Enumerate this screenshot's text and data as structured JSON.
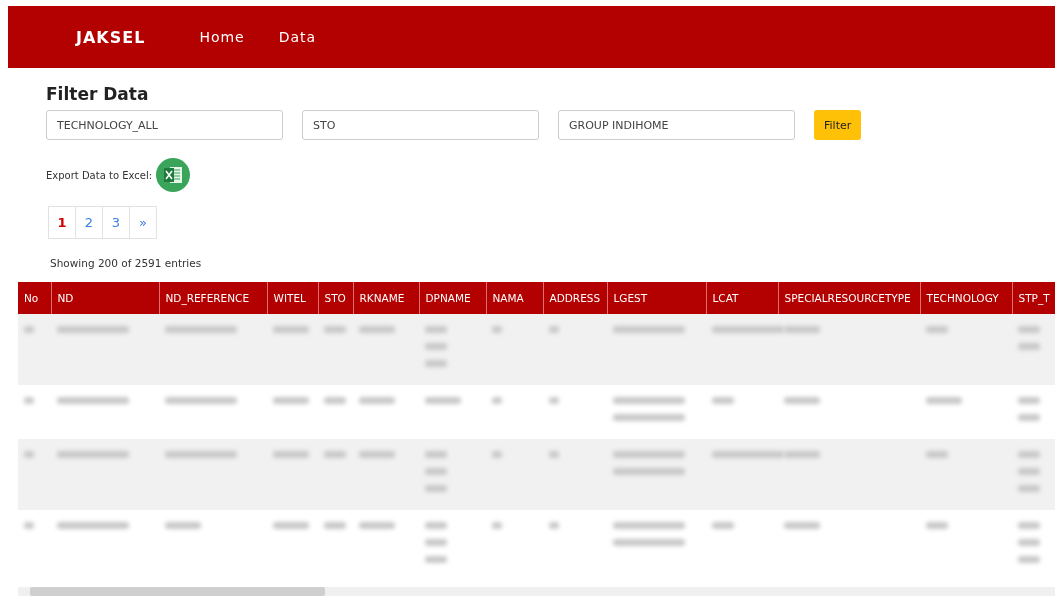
{
  "navbar": {
    "brand": "JAKSEL",
    "links": [
      {
        "label": "Home",
        "selected": false
      },
      {
        "label": "Data",
        "selected": false
      }
    ]
  },
  "filter": {
    "title": "Filter Data",
    "fields": [
      {
        "value": "TECHNOLOGY_ALL"
      },
      {
        "value": "STO"
      },
      {
        "value": "GROUP INDIHOME"
      }
    ],
    "button": "Filter"
  },
  "export": {
    "label": "Export Data to Excel:"
  },
  "pagination": {
    "pages": [
      {
        "label": "1",
        "selected": true
      },
      {
        "label": "2",
        "selected": false
      },
      {
        "label": "3",
        "selected": false
      },
      {
        "label": "»",
        "selected": false
      }
    ]
  },
  "summary": "Showing 200 of 2591 entries",
  "table": {
    "columns": [
      "No",
      "ND",
      "ND_REFERENCE",
      "WITEL",
      "STO",
      "RKNAME",
      "DPNAME",
      "NAMA",
      "ADDRESS",
      "LGEST",
      "LCAT",
      "SPECIALRESOURCETYPE",
      "TECHNOLOGY",
      "STP_T"
    ],
    "rows": [
      {
        "cells": [
          [
            {
              "kind": "tiny"
            }
          ],
          [
            {
              "kind": "long"
            }
          ],
          [
            {
              "kind": "long"
            }
          ],
          [
            {
              "kind": "medium"
            }
          ],
          [
            {
              "kind": "short"
            }
          ],
          [
            {
              "kind": "medium"
            }
          ],
          [
            {
              "kind": "short"
            },
            {
              "kind": "short"
            },
            {
              "kind": "short"
            }
          ],
          [
            {
              "kind": "tiny"
            }
          ],
          [
            {
              "kind": "tiny"
            }
          ],
          [
            {
              "kind": "long"
            }
          ],
          [
            {
              "kind": "long"
            }
          ],
          [
            {
              "kind": "medium"
            }
          ],
          [
            {
              "kind": "short"
            }
          ],
          [
            {
              "kind": "short"
            },
            {
              "kind": "short"
            }
          ]
        ]
      },
      {
        "cells": [
          [
            {
              "kind": "tiny"
            }
          ],
          [
            {
              "kind": "long"
            }
          ],
          [
            {
              "kind": "long"
            }
          ],
          [
            {
              "kind": "medium"
            }
          ],
          [
            {
              "kind": "short"
            }
          ],
          [
            {
              "kind": "medium"
            }
          ],
          [
            {
              "kind": "medium"
            }
          ],
          [
            {
              "kind": "tiny"
            }
          ],
          [
            {
              "kind": "tiny"
            }
          ],
          [
            {
              "kind": "long"
            },
            {
              "kind": "long"
            }
          ],
          [
            {
              "kind": "short"
            }
          ],
          [
            {
              "kind": "medium"
            }
          ],
          [
            {
              "kind": "medium"
            }
          ],
          [
            {
              "kind": "short"
            },
            {
              "kind": "short"
            }
          ]
        ]
      },
      {
        "cells": [
          [
            {
              "kind": "tiny"
            }
          ],
          [
            {
              "kind": "long"
            }
          ],
          [
            {
              "kind": "long"
            }
          ],
          [
            {
              "kind": "medium"
            }
          ],
          [
            {
              "kind": "short"
            }
          ],
          [
            {
              "kind": "medium"
            }
          ],
          [
            {
              "kind": "short"
            },
            {
              "kind": "short"
            },
            {
              "kind": "short"
            }
          ],
          [
            {
              "kind": "tiny"
            }
          ],
          [
            {
              "kind": "tiny"
            }
          ],
          [
            {
              "kind": "long"
            },
            {
              "kind": "long"
            }
          ],
          [
            {
              "kind": "long"
            }
          ],
          [
            {
              "kind": "medium"
            }
          ],
          [
            {
              "kind": "short"
            }
          ],
          [
            {
              "kind": "short"
            },
            {
              "kind": "short"
            },
            {
              "kind": "short"
            }
          ]
        ]
      },
      {
        "cells": [
          [
            {
              "kind": "tiny"
            }
          ],
          [
            {
              "kind": "long"
            }
          ],
          [
            {
              "kind": "medium"
            }
          ],
          [
            {
              "kind": "medium"
            }
          ],
          [
            {
              "kind": "short"
            }
          ],
          [
            {
              "kind": "medium"
            }
          ],
          [
            {
              "kind": "short"
            },
            {
              "kind": "short"
            },
            {
              "kind": "short"
            }
          ],
          [
            {
              "kind": "tiny"
            }
          ],
          [
            {
              "kind": "tiny"
            }
          ],
          [
            {
              "kind": "long"
            },
            {
              "kind": "long"
            }
          ],
          [
            {
              "kind": "short"
            }
          ],
          [
            {
              "kind": "medium"
            }
          ],
          [
            {
              "kind": "short"
            }
          ],
          [
            {
              "kind": "short"
            },
            {
              "kind": "short"
            },
            {
              "kind": "short"
            }
          ]
        ]
      }
    ]
  }
}
